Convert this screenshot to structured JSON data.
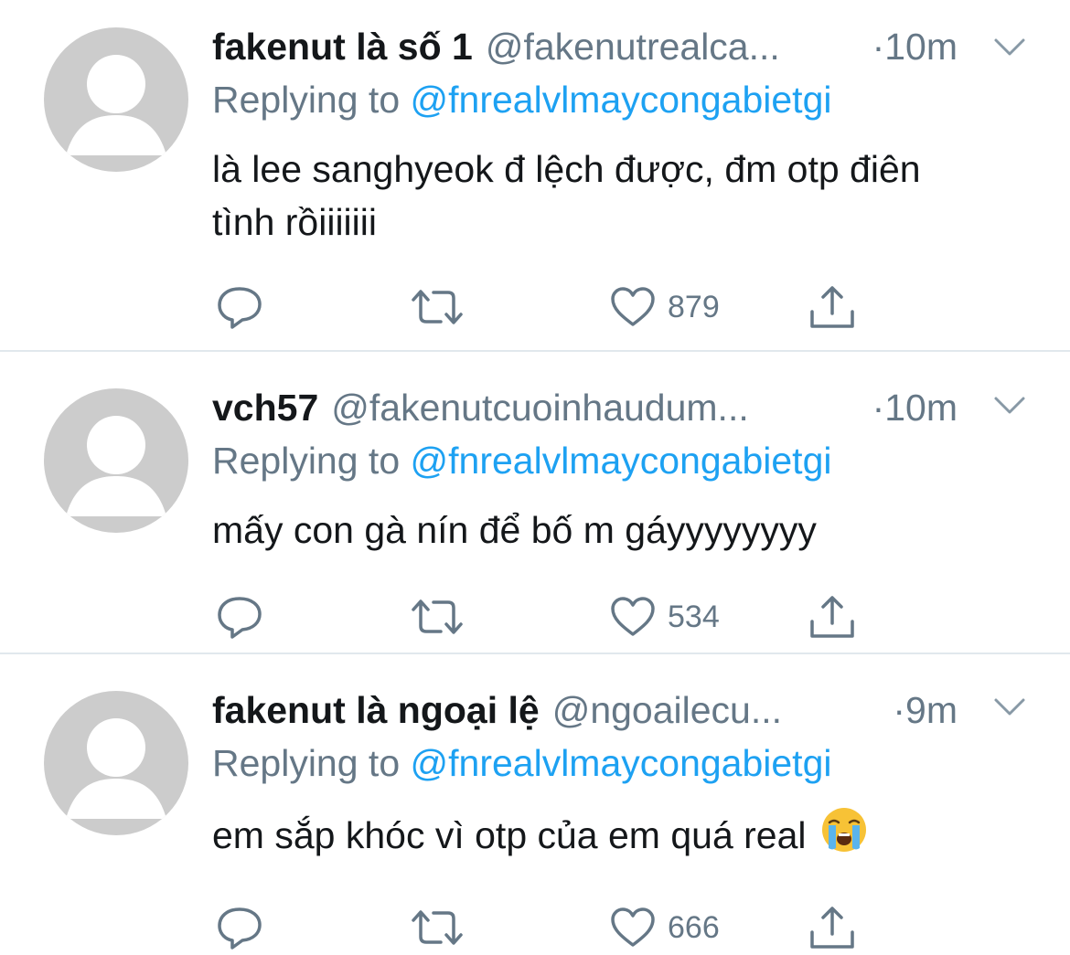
{
  "tweets": [
    {
      "display_name": "fakenut là số 1",
      "handle": "@fakenutrealca...",
      "dot": "·",
      "time": "10m",
      "replying_prefix": "Replying to ",
      "replying_to": "@fnrealvlmaycongabietgi",
      "text": "là lee sanghyeok đ lệch được, đm otp điên tình rồiiiiiii",
      "likes": "879",
      "icons": {
        "reply": "reply-icon",
        "retweet": "retweet-icon",
        "like": "heart-icon",
        "share": "share-icon",
        "menu": "chevron-down-icon"
      }
    },
    {
      "display_name": "vch57",
      "handle": "@fakenutcuoinhaudum...",
      "dot": "·",
      "time": "10m",
      "replying_prefix": "Replying to ",
      "replying_to": "@fnrealvlmaycongabietgi",
      "text": "mấy con gà nín để bố m gáyyyyyyyy",
      "likes": "534",
      "icons": {
        "reply": "reply-icon",
        "retweet": "retweet-icon",
        "like": "heart-icon",
        "share": "share-icon",
        "menu": "chevron-down-icon"
      }
    },
    {
      "display_name": "fakenut là ngoại lệ",
      "handle": "@ngoailecu...",
      "dot": "·",
      "time": "9m",
      "replying_prefix": "Replying to ",
      "replying_to": "@fnrealvlmaycongabietgi",
      "text": "em sắp khóc vì otp của em quá real",
      "emoji": "loudly-crying-face-emoji",
      "likes": "666",
      "icons": {
        "reply": "reply-icon",
        "retweet": "retweet-icon",
        "like": "heart-icon",
        "share": "share-icon",
        "menu": "chevron-down-icon"
      }
    }
  ],
  "colors": {
    "text_primary": "#14171a",
    "text_secondary": "#657786",
    "link": "#1da1f2",
    "avatar_placeholder": "#cccccc",
    "divider": "#e1e8ed"
  }
}
